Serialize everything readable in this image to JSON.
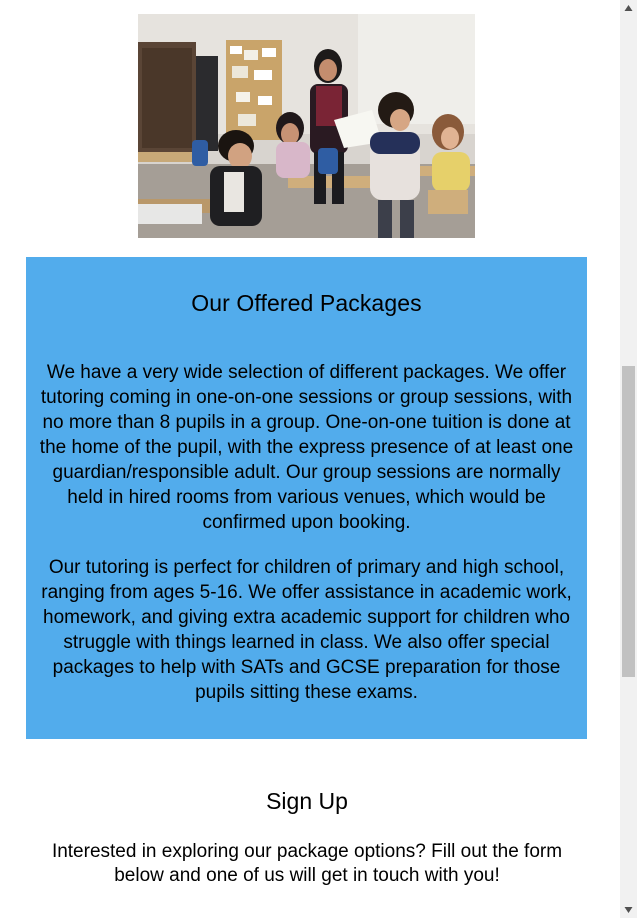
{
  "photo": {
    "alt": "Tutor handing papers to a group of children in a classroom"
  },
  "packages": {
    "title": "Our Offered Packages",
    "paragraph1": "We have a very wide selection of different packages. We offer tutoring coming in one-on-one sessions or group sessions, with no more than 8 pupils in a group. One-on-one tuition is done at the home of the pupil, with the express presence of at least one guardian/responsible adult. Our group sessions are normally held in hired rooms from various venues, which would be confirmed upon booking.",
    "paragraph2": "Our tutoring is perfect for children of primary and high school, ranging from ages 5-16. We offer assistance in academic work, homework, and giving extra academic support for children who struggle with things learned in class. We also offer special packages to help with SATs and GCSE preparation for those pupils sitting these exams.",
    "background": "#52acec"
  },
  "signup": {
    "title": "Sign Up",
    "text": "Interested in exploring our package options? Fill out the form below and one of us will get in touch with you!"
  },
  "scrollbar": {
    "up_icon": "scroll-up-arrow-icon",
    "down_icon": "scroll-down-arrow-icon"
  }
}
